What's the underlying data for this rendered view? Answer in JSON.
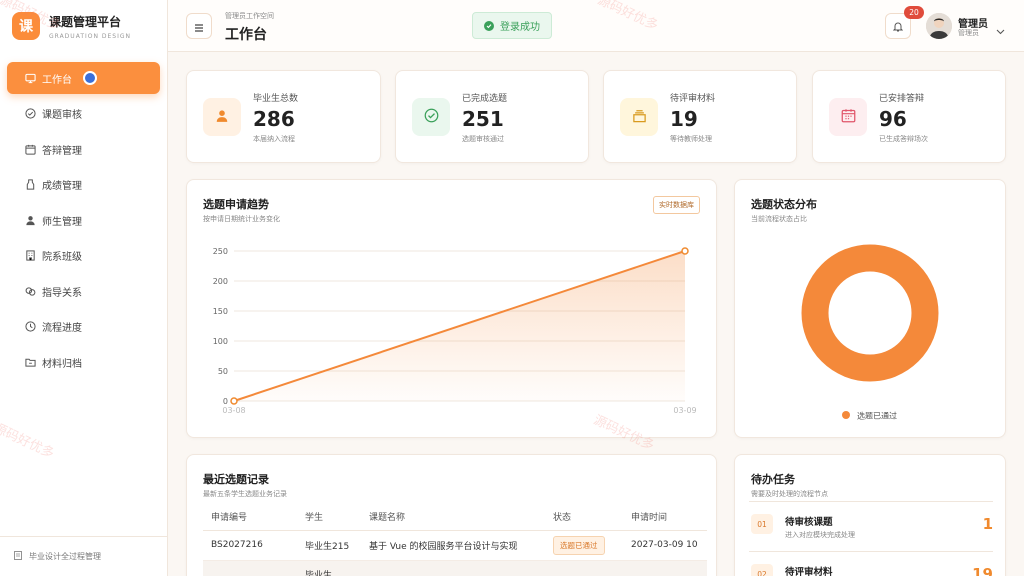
{
  "brand": {
    "logo_char": "课",
    "title": "课题管理平台",
    "subtitle": "GRADUATION DESIGN"
  },
  "sidebar": {
    "items": [
      {
        "label": "工作台",
        "icon": "dashboard-icon",
        "active": true
      },
      {
        "label": "课题审核",
        "icon": "check-circle-icon"
      },
      {
        "label": "答辩管理",
        "icon": "calendar-icon"
      },
      {
        "label": "成绩管理",
        "icon": "jar-icon"
      },
      {
        "label": "师生管理",
        "icon": "user-icon"
      },
      {
        "label": "院系班级",
        "icon": "building-icon"
      },
      {
        "label": "指导关系",
        "icon": "link-icon"
      },
      {
        "label": "流程进度",
        "icon": "clock-icon"
      },
      {
        "label": "材料归档",
        "icon": "folder-icon"
      }
    ],
    "footer": "毕业设计全过程管理"
  },
  "header": {
    "breadcrumb": "管理员工作空间",
    "title": "工作台",
    "toast": "登录成功",
    "notifications": "20",
    "user_name": "管理员",
    "user_role": "管理员"
  },
  "stats": [
    {
      "label": "毕业生总数",
      "value": "286",
      "sub": "本届纳入流程",
      "icon": "user-icon",
      "color": "#f08a2e",
      "bg": "#fff1e3"
    },
    {
      "label": "已完成选题",
      "value": "251",
      "sub": "选题审核通过",
      "icon": "check-circle-icon",
      "color": "#3aa05a",
      "bg": "#eaf7ee"
    },
    {
      "label": "待评审材料",
      "value": "19",
      "sub": "等待教师处理",
      "icon": "stack-icon",
      "color": "#d99a1e",
      "bg": "#fff6dc"
    },
    {
      "label": "已安排答辩",
      "value": "96",
      "sub": "已生成答辩场次",
      "icon": "calendar-icon",
      "color": "#e0566a",
      "bg": "#fdeef0"
    }
  ],
  "trend": {
    "title": "选题申请趋势",
    "subtitle": "按申请日期统计业务变化",
    "badge": "实时数据库"
  },
  "distribution": {
    "title": "选题状态分布",
    "subtitle": "当前流程状态占比",
    "legend": "选题已通过"
  },
  "recent": {
    "title": "最近选题记录",
    "subtitle": "最新五条学生选题业务记录",
    "columns": [
      "申请编号",
      "学生",
      "课题名称",
      "状态",
      "申请时间"
    ],
    "rows": [
      {
        "id": "BS2027216",
        "student": "毕业生215",
        "topic": "基于 Vue 的校园服务平台设计与实现",
        "status": "选题已通过",
        "time": "2027-03-09 10"
      },
      {
        "id": "",
        "student": "毕业生",
        "topic": "",
        "status": "",
        "time": ""
      }
    ]
  },
  "todos": {
    "title": "待办任务",
    "subtitle": "需要及时处理的流程节点",
    "items": [
      {
        "num": "01",
        "title": "待审核课题",
        "sub": "进入对应模块完成处理",
        "count": "1"
      },
      {
        "num": "02",
        "title": "待评审材料",
        "sub": "",
        "count": "19"
      }
    ]
  },
  "watermark": "源码好优多",
  "chart_data": [
    {
      "type": "area",
      "x": [
        "03-08",
        "03-09"
      ],
      "series": [
        {
          "values": [
            0,
            250
          ]
        }
      ],
      "yticks": [
        0,
        50,
        100,
        150,
        200,
        250
      ],
      "ylim": [
        0,
        250
      ],
      "color": "#f08a2e",
      "grid": true
    },
    {
      "type": "pie",
      "donut": true,
      "categories": [
        "选题已通过"
      ],
      "values": [
        251
      ],
      "colors": [
        "#f4893a"
      ],
      "legend": "bottom"
    }
  ]
}
